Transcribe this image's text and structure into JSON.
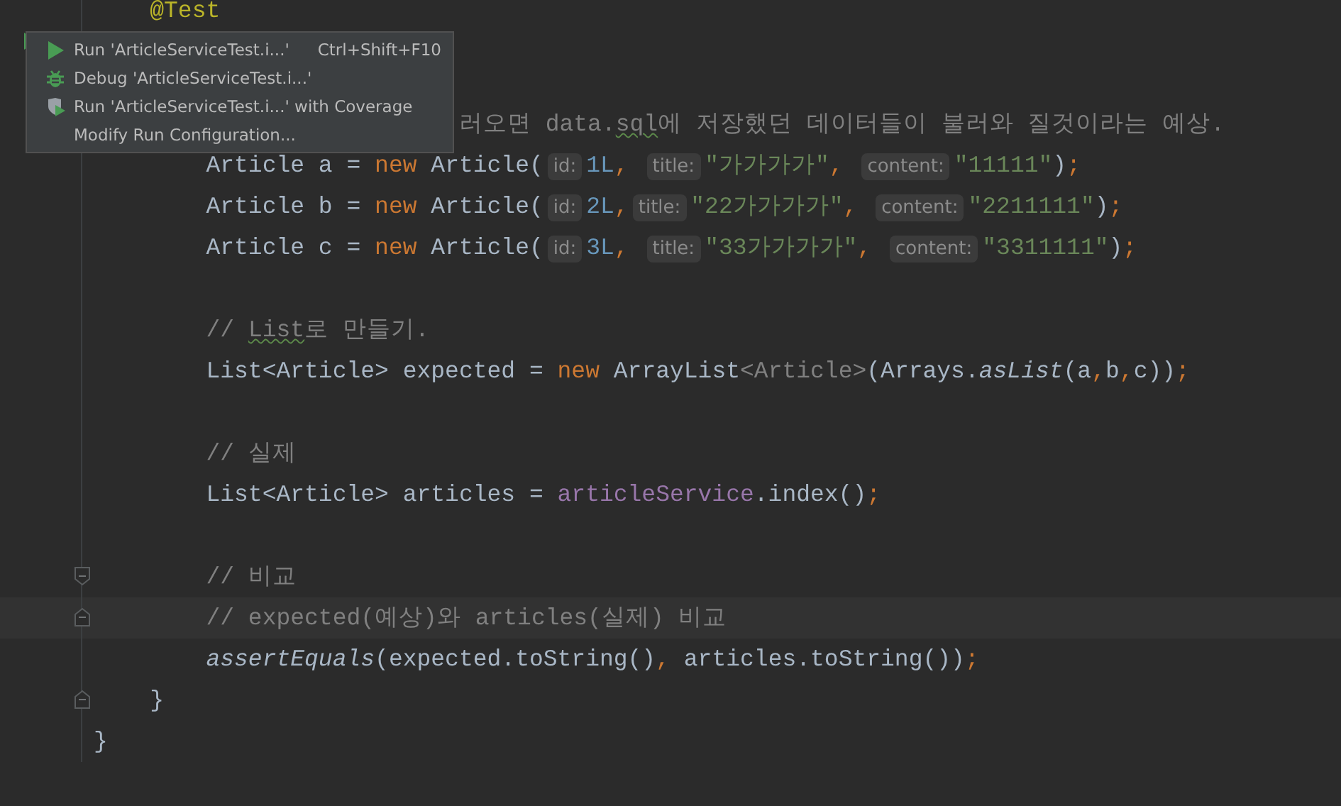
{
  "editor": {
    "lines": [
      {
        "kind": "plain",
        "tokens": [
          {
            "kind": "annotation",
            "text": "    @Test"
          }
        ]
      },
      {
        "kind": "plain"
      },
      {
        "kind": "plain"
      },
      {
        "kind": "plain",
        "tokens": [
          {
            "kind": "comment",
            "text": "                          러오면 data."
          },
          {
            "kind": "typo",
            "text": "sql"
          },
          {
            "kind": "comment",
            "text": "에 저장했던 데이터들이 불러와 질것이라는 예상."
          }
        ]
      },
      {
        "kind": "plain",
        "tokens": [
          {
            "kind": "plain",
            "text": "        Article a = "
          },
          {
            "kind": "keyword",
            "text": "new"
          },
          {
            "kind": "plain",
            "text": " Article("
          },
          {
            "kind": "hint",
            "text": "id:"
          },
          {
            "kind": "number",
            "text": "1L"
          },
          {
            "kind": "punct",
            "text": ", "
          },
          {
            "kind": "hint",
            "text": "title:"
          },
          {
            "kind": "string",
            "text": "\"가가가가\""
          },
          {
            "kind": "punct",
            "text": ", "
          },
          {
            "kind": "hint",
            "text": "content:"
          },
          {
            "kind": "string",
            "text": "\"11111\""
          },
          {
            "kind": "plain",
            "text": ")"
          },
          {
            "kind": "punct",
            "text": ";"
          }
        ]
      },
      {
        "kind": "plain",
        "tokens": [
          {
            "kind": "plain",
            "text": "        Article b = "
          },
          {
            "kind": "keyword",
            "text": "new"
          },
          {
            "kind": "plain",
            "text": " Article("
          },
          {
            "kind": "hint",
            "text": "id:"
          },
          {
            "kind": "number",
            "text": "2L"
          },
          {
            "kind": "punct",
            "text": ","
          },
          {
            "kind": "hint",
            "text": "title:"
          },
          {
            "kind": "string",
            "text": "\"22가가가가\""
          },
          {
            "kind": "punct",
            "text": ", "
          },
          {
            "kind": "hint",
            "text": "content:"
          },
          {
            "kind": "string",
            "text": "\"2211111\""
          },
          {
            "kind": "plain",
            "text": ")"
          },
          {
            "kind": "punct",
            "text": ";"
          }
        ]
      },
      {
        "kind": "plain",
        "tokens": [
          {
            "kind": "plain",
            "text": "        Article c = "
          },
          {
            "kind": "keyword",
            "text": "new"
          },
          {
            "kind": "plain",
            "text": " Article("
          },
          {
            "kind": "hint",
            "text": "id:"
          },
          {
            "kind": "number",
            "text": "3L"
          },
          {
            "kind": "punct",
            "text": ", "
          },
          {
            "kind": "hint",
            "text": "title:"
          },
          {
            "kind": "string",
            "text": "\"33가가가가\""
          },
          {
            "kind": "punct",
            "text": ", "
          },
          {
            "kind": "hint",
            "text": "content:"
          },
          {
            "kind": "string",
            "text": "\"3311111\""
          },
          {
            "kind": "plain",
            "text": ")"
          },
          {
            "kind": "punct",
            "text": ";"
          }
        ]
      },
      {
        "kind": "plain"
      },
      {
        "kind": "plain",
        "tokens": [
          {
            "kind": "comment",
            "text": "        // "
          },
          {
            "kind": "typo",
            "text": "List"
          },
          {
            "kind": "comment",
            "text": "로 만들기."
          }
        ]
      },
      {
        "kind": "plain",
        "tokens": [
          {
            "kind": "plain",
            "text": "        List<Article> expected = "
          },
          {
            "kind": "keyword",
            "text": "new"
          },
          {
            "kind": "plain",
            "text": " ArrayList"
          },
          {
            "kind": "typeparam",
            "text": "<Article>"
          },
          {
            "kind": "plain",
            "text": "(Arrays."
          },
          {
            "kind": "italic",
            "text": "asList"
          },
          {
            "kind": "plain",
            "text": "(a"
          },
          {
            "kind": "punct",
            "text": ","
          },
          {
            "kind": "plain",
            "text": "b"
          },
          {
            "kind": "punct",
            "text": ","
          },
          {
            "kind": "plain",
            "text": "c))"
          },
          {
            "kind": "punct",
            "text": ";"
          }
        ]
      },
      {
        "kind": "plain"
      },
      {
        "kind": "plain",
        "tokens": [
          {
            "kind": "comment",
            "text": "        // 실제"
          }
        ]
      },
      {
        "kind": "plain",
        "tokens": [
          {
            "kind": "plain",
            "text": "        List<Article> articles = "
          },
          {
            "kind": "field",
            "text": "articleService"
          },
          {
            "kind": "plain",
            "text": ".index()"
          },
          {
            "kind": "punct",
            "text": ";"
          }
        ]
      },
      {
        "kind": "plain"
      },
      {
        "kind": "fold_end",
        "tokens": [
          {
            "kind": "comment",
            "text": "        // 비교"
          }
        ]
      },
      {
        "kind": "fold_start",
        "current": true,
        "tokens": [
          {
            "kind": "comment",
            "text": "        // expected(예상)와 articles(실제) 비교"
          }
        ]
      },
      {
        "kind": "plain",
        "tokens": [
          {
            "kind": "italic",
            "text": "        assertEquals"
          },
          {
            "kind": "plain",
            "text": "(expected.toString()"
          },
          {
            "kind": "punct",
            "text": ", "
          },
          {
            "kind": "plain",
            "text": "articles.toString())"
          },
          {
            "kind": "punct",
            "text": ";"
          }
        ]
      },
      {
        "kind": "fold_start",
        "tokens": [
          {
            "kind": "plain",
            "text": "    }"
          }
        ]
      },
      {
        "kind": "plain",
        "tokens": [
          {
            "kind": "plain",
            "text": "}"
          }
        ]
      }
    ]
  },
  "popup": {
    "items": [
      {
        "kind": "run",
        "label": "Run 'ArticleServiceTest.i...'",
        "shortcut": "Ctrl+Shift+F10"
      },
      {
        "kind": "debug",
        "label": "Debug 'ArticleServiceTest.i...'"
      },
      {
        "kind": "coverage",
        "label": "Run 'ArticleServiceTest.i...' with Coverage"
      },
      {
        "kind": "plain",
        "label": "Modify Run Configuration..."
      }
    ]
  }
}
